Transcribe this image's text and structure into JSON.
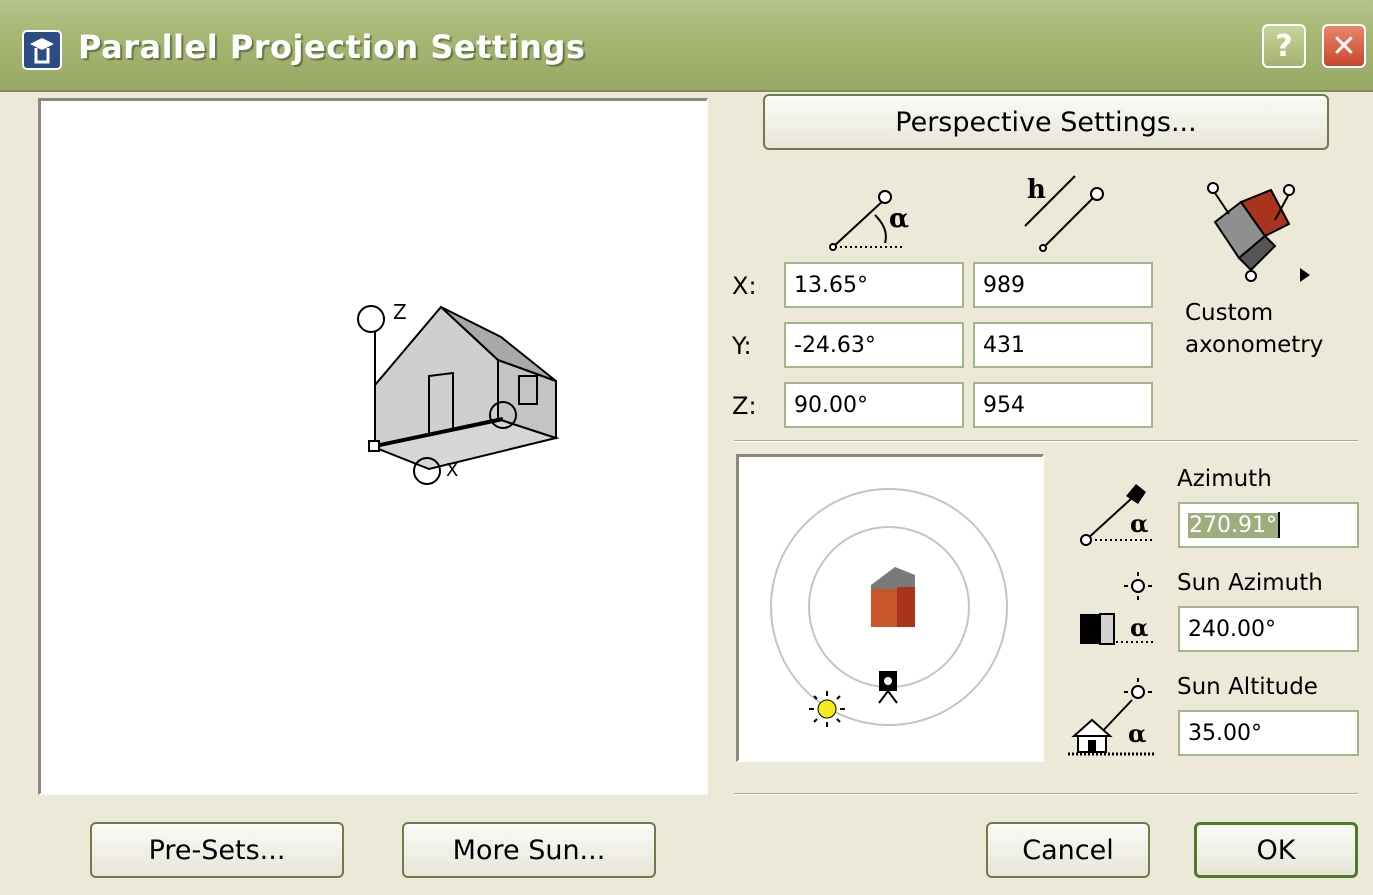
{
  "window": {
    "title": "Parallel Projection Settings",
    "help_label": "?",
    "close_label": "✕"
  },
  "buttons": {
    "perspective": "Perspective Settings...",
    "presets": "Pre-Sets...",
    "more_sun": "More Sun...",
    "cancel": "Cancel",
    "ok": "OK"
  },
  "axes": {
    "rows": [
      {
        "label": "X:",
        "angle": "13.65°",
        "length": "989"
      },
      {
        "label": "Y:",
        "angle": "-24.63°",
        "length": "431"
      },
      {
        "label": "Z:",
        "angle": "90.00°",
        "length": "954"
      }
    ],
    "h_symbol": "h",
    "alpha_symbol": "α"
  },
  "projection_type": {
    "line1": "Custom",
    "line2": "axonometry"
  },
  "preview_axis_labels": {
    "z": "Z",
    "x": "X"
  },
  "sun": {
    "azimuth_label": "Azimuth",
    "azimuth_value": "270.91°",
    "sun_azimuth_label": "Sun Azimuth",
    "sun_azimuth_value": "240.00°",
    "sun_altitude_label": "Sun Altitude",
    "sun_altitude_value": "35.00°"
  },
  "colors": {
    "roof": "#a8341e",
    "wall": "#c9562b",
    "sun": "#f5ea1c"
  }
}
